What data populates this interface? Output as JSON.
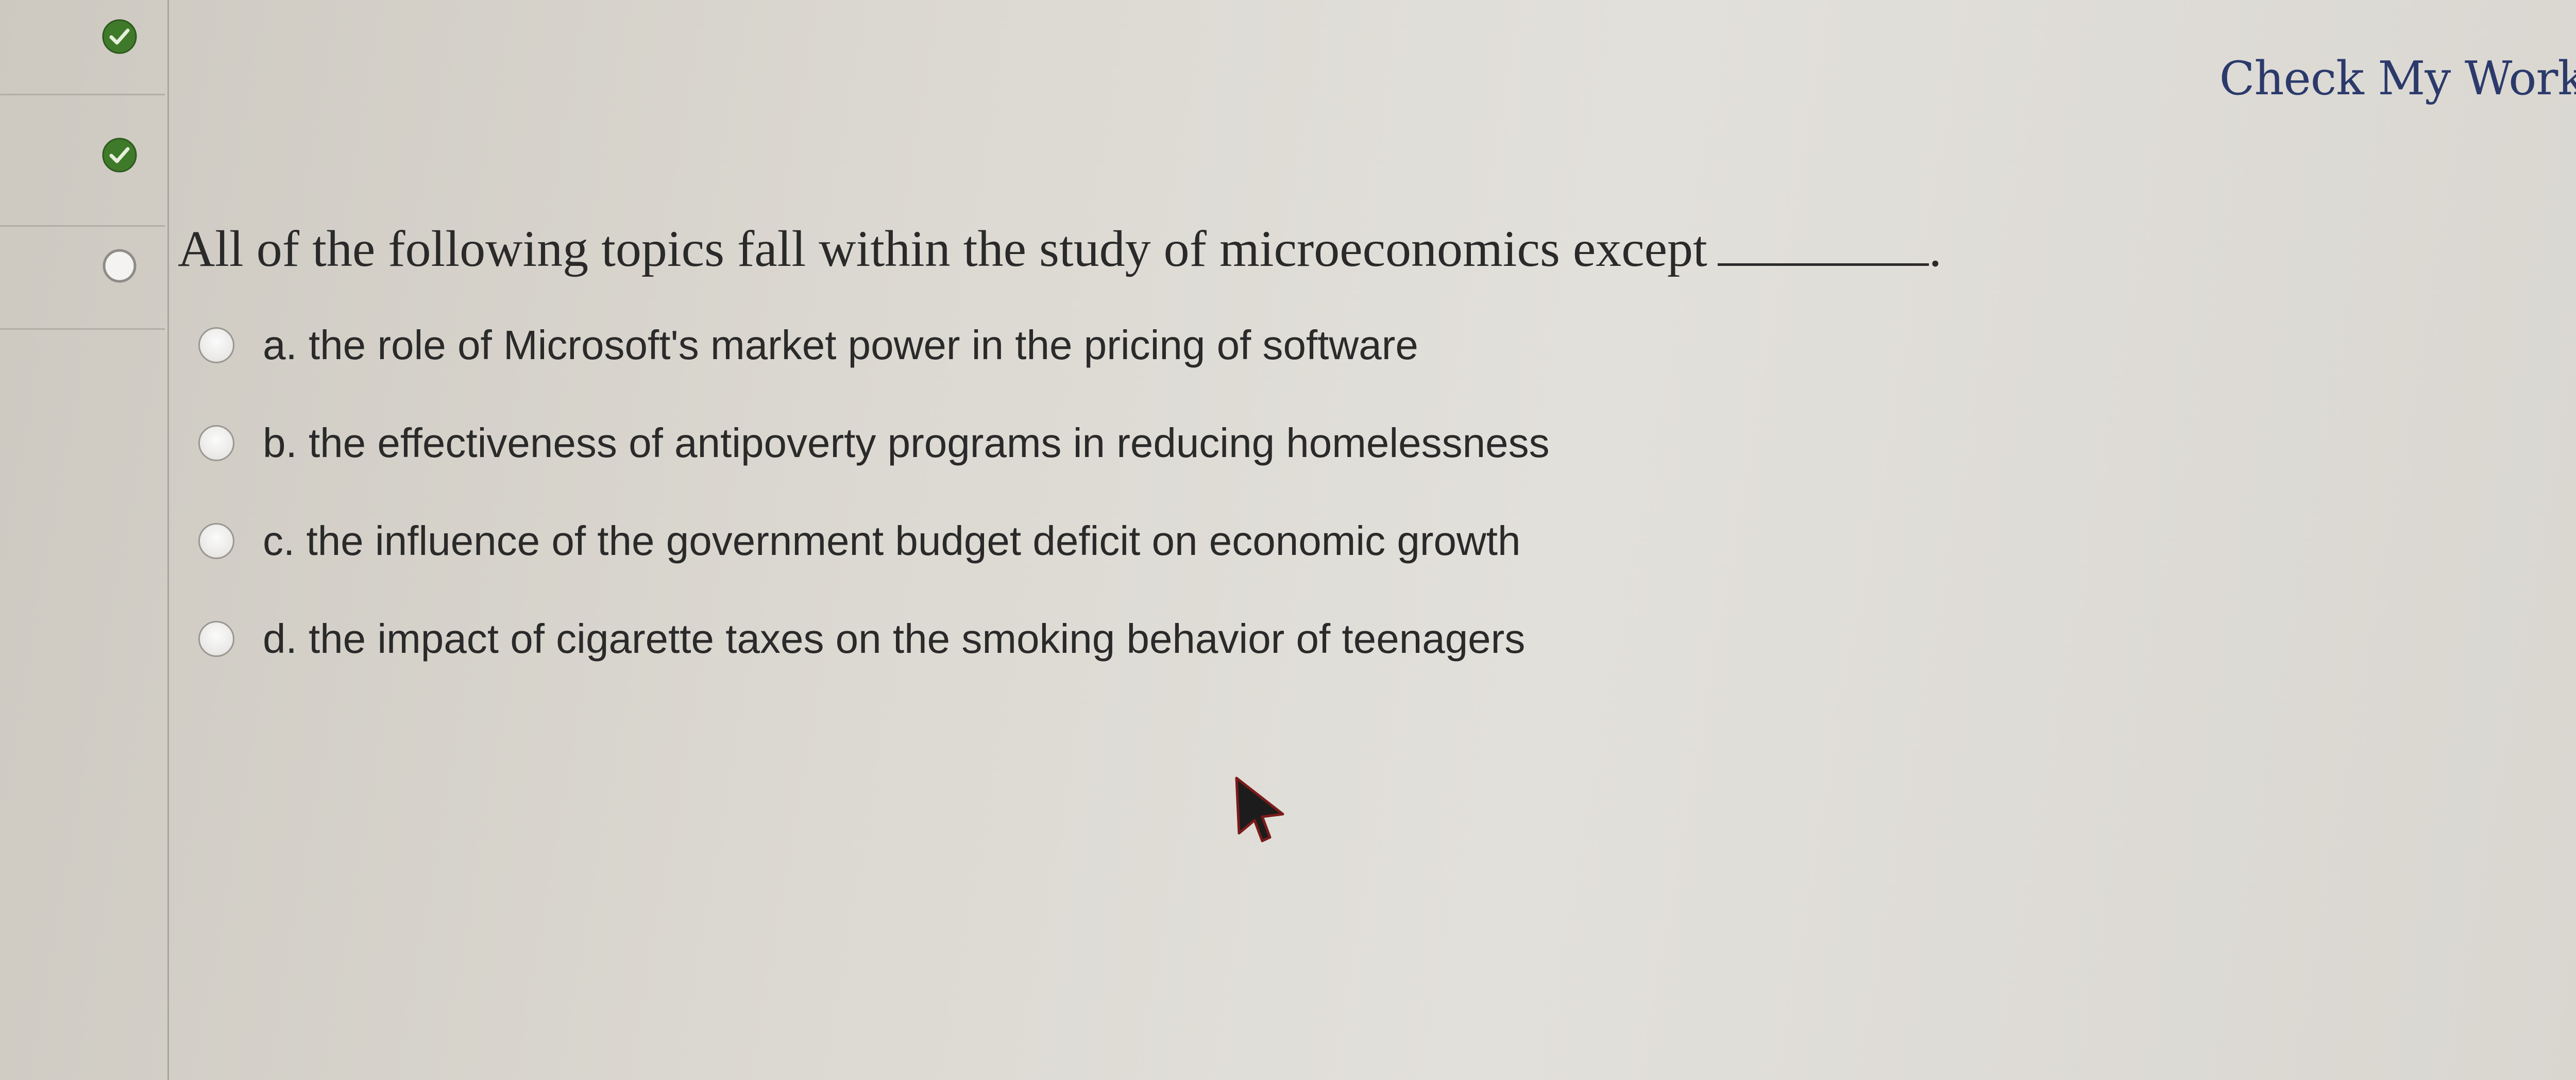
{
  "header": {
    "check_my_work_label": "Check My Work"
  },
  "sidebar": {
    "markers": [
      {
        "status": "answered",
        "icon": "check-circle-icon",
        "color": "#3f7a2a"
      },
      {
        "status": "answered",
        "icon": "check-circle-icon",
        "color": "#3f7a2a"
      },
      {
        "status": "current",
        "icon": "empty-circle-icon",
        "color": "#ffffff"
      }
    ]
  },
  "question": {
    "prompt": "All of the following topics fall within the study of microeconomics except",
    "blank_suffix": ".",
    "options": [
      {
        "label": "a. the role of Microsoft's market power in the pricing of software"
      },
      {
        "label": "b. the effectiveness of antipoverty programs in reducing homelessness"
      },
      {
        "label": "c. the influence of the government budget deficit on economic growth"
      },
      {
        "label": "d. the impact of cigarette taxes on the smoking behavior of teenagers"
      }
    ]
  },
  "colors": {
    "link": "#2b3a6b",
    "text": "#2a2a2a",
    "check_green": "#3f7a2a"
  }
}
